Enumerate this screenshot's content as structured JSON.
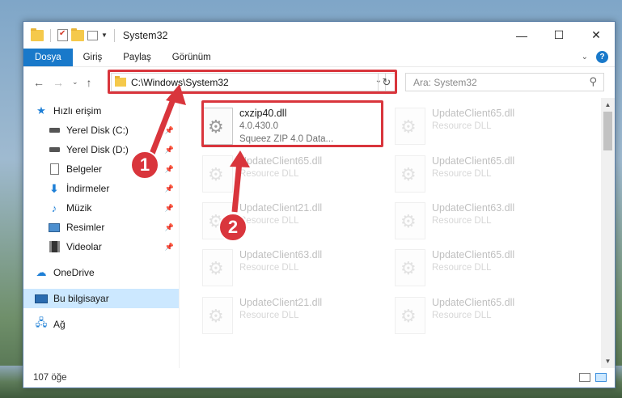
{
  "window": {
    "title": "System32",
    "controls": {
      "minimize": "—",
      "maximize": "☐",
      "close": "✕"
    }
  },
  "ribbon": {
    "tabs": [
      "Dosya",
      "Giriş",
      "Paylaş",
      "Görünüm"
    ],
    "help": "?"
  },
  "address": {
    "path": "C:\\Windows\\System32",
    "search_placeholder": "Ara: System32"
  },
  "sidebar": {
    "quick_access": "Hızlı erişim",
    "items": [
      {
        "label": "Yerel Disk (C:)",
        "icon": "drive-icon"
      },
      {
        "label": "Yerel Disk (D:)",
        "icon": "drive-icon"
      },
      {
        "label": "Belgeler",
        "icon": "documents-icon"
      },
      {
        "label": "İndirmeler",
        "icon": "downloads-icon"
      },
      {
        "label": "Müzik",
        "icon": "music-icon"
      },
      {
        "label": "Resimler",
        "icon": "pictures-icon"
      },
      {
        "label": "Videolar",
        "icon": "videos-icon"
      }
    ],
    "onedrive": "OneDrive",
    "this_pc": "Bu bilgisayar",
    "network": "Ağ"
  },
  "files": [
    {
      "name": "cxzip40.dll",
      "line2": "4.0.430.0",
      "line3": "Squeez ZIP 4.0 Data...",
      "highlight": true
    },
    {
      "name": "UpdateClient65.dll",
      "line2": "Resource DLL"
    },
    {
      "name": "UpdateClient65.dll",
      "line2": "Resource DLL"
    },
    {
      "name": "UpdateClient65.dll",
      "line2": "Resource DLL"
    },
    {
      "name": "UpdateClient21.dll",
      "line2": "Resource DLL"
    },
    {
      "name": "UpdateClient63.dll",
      "line2": "Resource DLL"
    },
    {
      "name": "UpdateClient63.dll",
      "line2": "Resource DLL"
    },
    {
      "name": "UpdateClient65.dll",
      "line2": "Resource DLL"
    },
    {
      "name": "UpdateClient21.dll",
      "line2": "Resource DLL"
    },
    {
      "name": "UpdateClient65.dll",
      "line2": "Resource DLL"
    }
  ],
  "status": {
    "count": "107 öğe"
  },
  "annotations": {
    "step1": "1",
    "step2": "2"
  },
  "colors": {
    "accent": "#1979ca",
    "highlight_red": "#d9353c",
    "selection": "#cce8ff"
  }
}
